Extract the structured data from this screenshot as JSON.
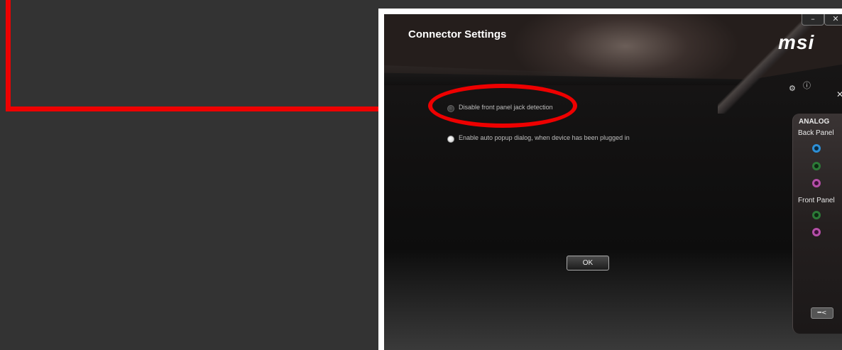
{
  "window": {
    "title": "Connector Settings",
    "logo": "msi",
    "minimize_label": "–",
    "close_label": "✕"
  },
  "options": [
    {
      "label": "Disable front panel jack detection",
      "selected": false
    },
    {
      "label": "Enable auto popup dialog, when device has been plugged in",
      "selected": true
    }
  ],
  "ok_label": "OK",
  "side_panel": {
    "heading": "ANALOG",
    "back_panel": "Back Panel",
    "front_panel": "Front Panel",
    "jack_colors": {
      "blue": "#2d8fd6",
      "green": "#2c7a37",
      "pink": "#b54fa8"
    }
  },
  "colors": {
    "annotation": "#ee0000",
    "background": "#333333"
  },
  "icons": [
    "settings-gear-icon",
    "info-icon",
    "panel-close-icon",
    "connector-tool-icon"
  ]
}
